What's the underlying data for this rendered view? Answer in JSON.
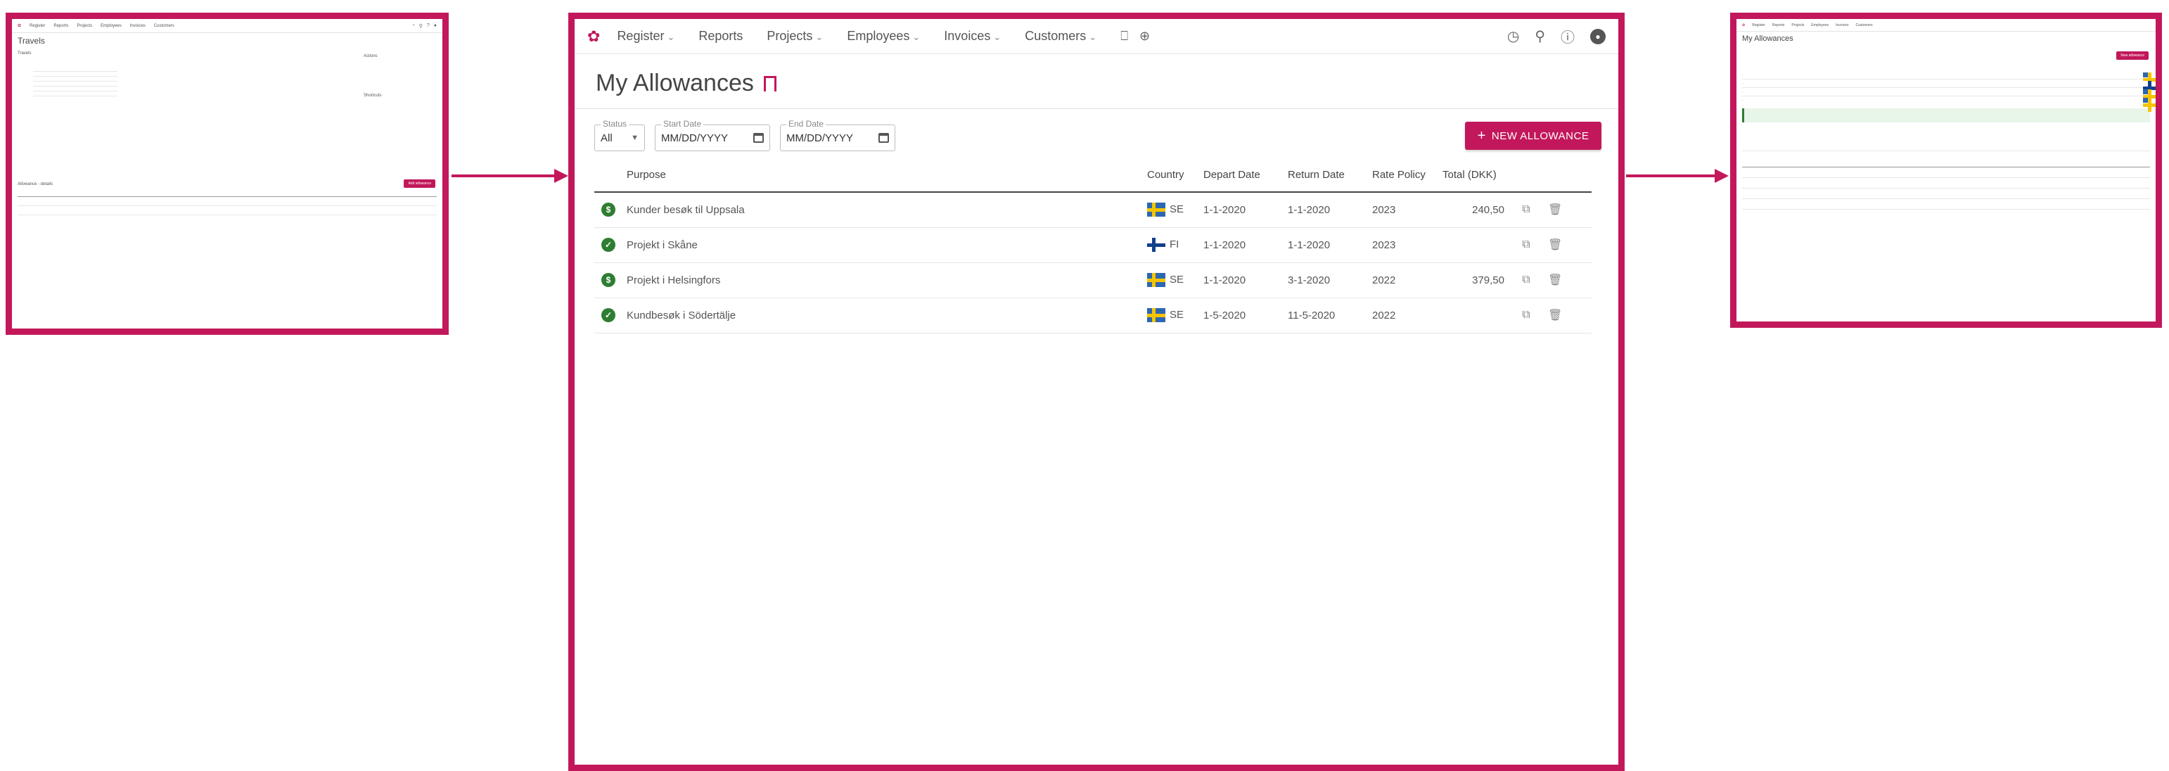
{
  "nav": {
    "items": [
      {
        "label": "Register",
        "dropdown": true
      },
      {
        "label": "Reports",
        "dropdown": false
      },
      {
        "label": "Projects",
        "dropdown": true
      },
      {
        "label": "Employees",
        "dropdown": true
      },
      {
        "label": "Invoices",
        "dropdown": true
      },
      {
        "label": "Customers",
        "dropdown": true
      }
    ]
  },
  "page": {
    "title": "My Allowances"
  },
  "filters": {
    "status_legend": "Status",
    "status_value": "All",
    "start_legend": "Start Date",
    "start_placeholder": "MM/DD/YYYY",
    "end_legend": "End Date",
    "end_placeholder": "MM/DD/YYYY"
  },
  "new_button": {
    "label": "NEW ALLOWANCE"
  },
  "table": {
    "headers": {
      "purpose": "Purpose",
      "country": "Country",
      "depart": "Depart Date",
      "return": "Return Date",
      "policy": "Rate Policy",
      "total": "Total (DKK)"
    },
    "rows": [
      {
        "status": "$",
        "purpose": "Kunder besøk til Uppsala",
        "flag": "se",
        "country": "SE",
        "depart": "1-1-2020",
        "return": "1-1-2020",
        "policy": "2023",
        "total": "240,50"
      },
      {
        "status": "✓",
        "purpose": "Projekt i Skåne",
        "flag": "fi",
        "country": "FI",
        "depart": "1-1-2020",
        "return": "1-1-2020",
        "policy": "2023",
        "total": ""
      },
      {
        "status": "$",
        "purpose": "Projekt i Helsingfors",
        "flag": "se",
        "country": "SE",
        "depart": "1-1-2020",
        "return": "3-1-2020",
        "policy": "2022",
        "total": "379,50"
      },
      {
        "status": "✓",
        "purpose": "Kundbesøk i Södertälje",
        "flag": "se",
        "country": "SE",
        "depart": "1-5-2020",
        "return": "11-5-2020",
        "policy": "2022",
        "total": ""
      }
    ]
  },
  "left_panel": {
    "title": "Travels",
    "section_travel": "Travels",
    "section_actions": "Actions",
    "section_shortcuts": "Shortcuts",
    "section_allowance": "Allowance - details",
    "add_button": "Add allowance"
  },
  "right_panel": {
    "title": "My Allowances",
    "button": "New allowance"
  },
  "colors": {
    "accent": "#c2185b",
    "success": "#2e7d32"
  }
}
